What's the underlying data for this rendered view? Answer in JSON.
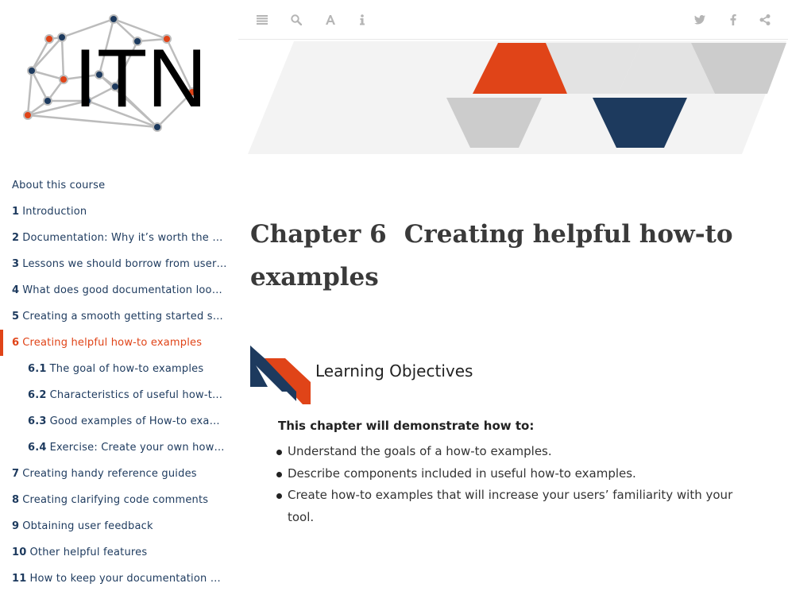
{
  "sidebar": {
    "logo_text": "ITN",
    "items": [
      {
        "num": "",
        "label": "About this course",
        "active": false,
        "sub": false
      },
      {
        "num": "1",
        "label": "Introduction",
        "active": false,
        "sub": false
      },
      {
        "num": "2",
        "label": "Documentation: Why it’s worth the eff…",
        "active": false,
        "sub": false
      },
      {
        "num": "3",
        "label": "Lessons we should borrow from user d…",
        "active": false,
        "sub": false
      },
      {
        "num": "4",
        "label": "What does good documentation look l…",
        "active": false,
        "sub": false
      },
      {
        "num": "5",
        "label": "Creating a smooth getting started sect…",
        "active": false,
        "sub": false
      },
      {
        "num": "6",
        "label": "Creating helpful how-to examples",
        "active": true,
        "sub": false
      },
      {
        "num": "6.1",
        "label": "The goal of how-to examples",
        "active": false,
        "sub": true
      },
      {
        "num": "6.2",
        "label": "Characteristics of useful how-to e…",
        "active": false,
        "sub": true
      },
      {
        "num": "6.3",
        "label": "Good examples of How-to exampl…",
        "active": false,
        "sub": true
      },
      {
        "num": "6.4",
        "label": "Exercise: Create your own how-to …",
        "active": false,
        "sub": true
      },
      {
        "num": "7",
        "label": "Creating handy reference guides",
        "active": false,
        "sub": false
      },
      {
        "num": "8",
        "label": "Creating clarifying code comments",
        "active": false,
        "sub": false
      },
      {
        "num": "9",
        "label": "Obtaining user feedback",
        "active": false,
        "sub": false
      },
      {
        "num": "10",
        "label": "Other helpful features",
        "active": false,
        "sub": false
      },
      {
        "num": "11",
        "label": "How to keep your documentation up t…",
        "active": false,
        "sub": false
      }
    ]
  },
  "toolbar": {
    "left": [
      "toc-toggle-icon",
      "search-icon",
      "font-settings-icon",
      "info-icon"
    ],
    "right": [
      "twitter-icon",
      "facebook-icon",
      "share-icon"
    ]
  },
  "main": {
    "chapter_label": "Chapter 6",
    "chapter_title": "Creating helpful how-to examples",
    "learning_objectives": {
      "title": "Learning Objectives",
      "intro": "This chapter will demonstrate how to:",
      "items": [
        "Understand the goals of a how-to examples.",
        "Describe components included in useful how-to examples.",
        "Create how-to examples that will increase your users’ familiarity with your tool."
      ]
    }
  },
  "colors": {
    "accent": "#e04418",
    "navy": "#1d3a5e",
    "banner_grey": "#cccccc",
    "banner_light": "#e6e6e6"
  }
}
